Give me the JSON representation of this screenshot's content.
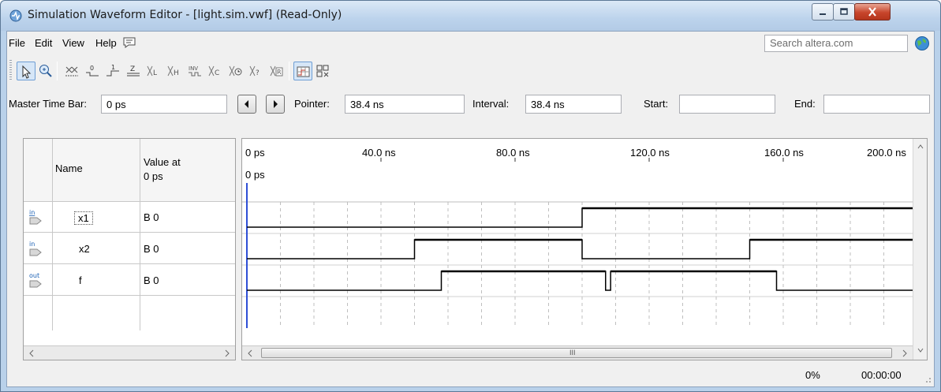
{
  "window": {
    "title": "Simulation Waveform Editor - [light.sim.vwf] (Read-Only)"
  },
  "menu": {
    "items": [
      "File",
      "Edit",
      "View",
      "Help"
    ],
    "search_placeholder": "Search altera.com"
  },
  "timebar": {
    "master_label": "Master Time Bar:",
    "master_value": "0 ps",
    "pointer_label": "Pointer:",
    "pointer_value": "38.4 ns",
    "interval_label": "Interval:",
    "interval_value": "38.4 ns",
    "start_label": "Start:",
    "start_value": "",
    "end_label": "End:",
    "end_value": ""
  },
  "grid": {
    "col_name": "Name",
    "col_value_line1": "Value at",
    "col_value_line2": "0 ps",
    "rows": [
      {
        "pin_type": "in",
        "name": "x1",
        "value": "B 0"
      },
      {
        "pin_type": "in",
        "name": "x2",
        "value": "B 0"
      },
      {
        "pin_type": "out",
        "name": "f",
        "value": "B 0"
      }
    ]
  },
  "waveform": {
    "ticks": [
      "0 ps",
      "40.0 ns",
      "80.0 ns",
      "120.0 ns",
      "160.0 ns",
      "200.0 ns"
    ],
    "cursor_label": "0 ps",
    "signals": [
      {
        "name": "x1",
        "transitions_ns": [
          0,
          100
        ],
        "levels": [
          0,
          1
        ]
      },
      {
        "name": "x2",
        "transitions_ns": [
          0,
          50,
          100,
          150
        ],
        "levels": [
          0,
          1,
          0,
          1
        ]
      },
      {
        "name": "f",
        "transitions_ns": [
          0,
          58,
          107,
          108.5,
          158
        ],
        "levels": [
          0,
          1,
          0,
          1,
          0
        ]
      }
    ]
  },
  "scroll": {
    "h_mark": "III"
  },
  "status": {
    "progress": "0%",
    "time": "00:00:00"
  },
  "icons": [
    "select-icon",
    "zoom-icon",
    "dont-care-icon",
    "force-low-icon",
    "force-high-icon",
    "high-impedance-icon",
    "weak-low-icon",
    "weak-high-icon",
    "invert-icon",
    "count-value-icon",
    "clock-icon",
    "arbitrary-value-icon",
    "random-value-icon",
    "snap-to-grid-icon",
    "sort-icon"
  ]
}
